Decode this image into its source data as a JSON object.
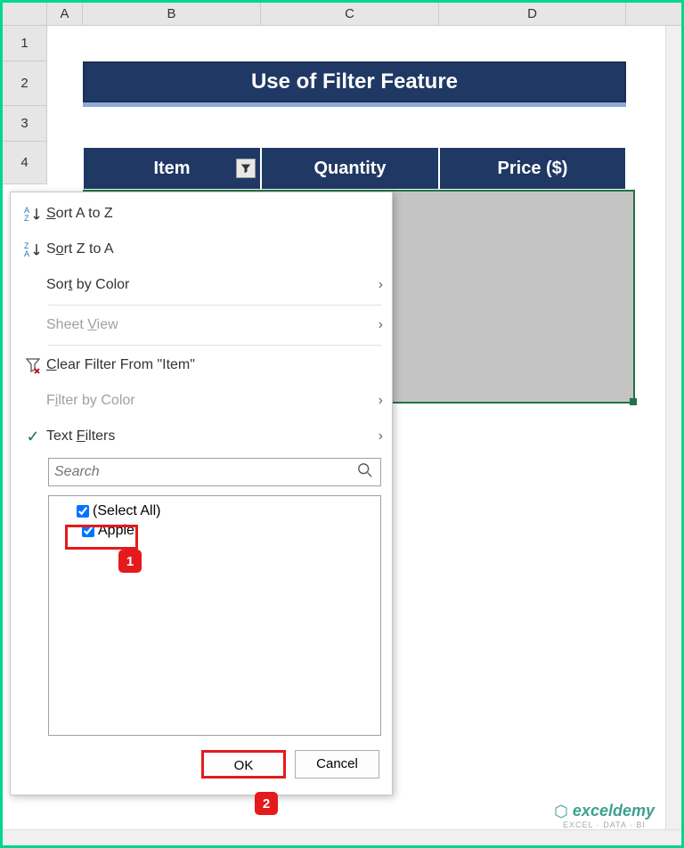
{
  "columns": {
    "A": "A",
    "B": "B",
    "C": "C",
    "D": "D"
  },
  "rows": [
    "1",
    "2",
    "3",
    "4"
  ],
  "title": "Use of Filter Feature",
  "headers": {
    "item": "Item",
    "qty": "Quantity",
    "price": "Price ($)"
  },
  "menu": {
    "sortAZ": "Sort A to Z",
    "sortZA": "Sort Z to A",
    "sortColor": "Sort by Color",
    "sheetView": "Sheet View",
    "clearFilter": "Clear Filter From \"Item\"",
    "filterColor": "Filter by Color",
    "textFilters": "Text Filters",
    "searchPlaceholder": "Search"
  },
  "filterItems": {
    "selectAll": "(Select All)",
    "apple": "Apple"
  },
  "buttons": {
    "ok": "OK",
    "cancel": "Cancel"
  },
  "callouts": {
    "one": "1",
    "two": "2"
  },
  "watermark": {
    "brand": "exceldemy",
    "sub": "EXCEL · DATA · BI"
  }
}
